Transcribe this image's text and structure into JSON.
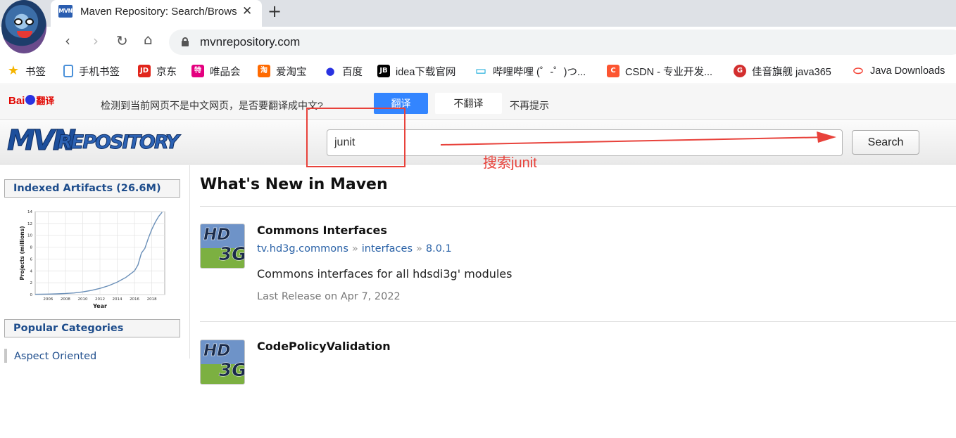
{
  "browser": {
    "tab_title": "Maven Repository: Search/Browse",
    "tab_favicon": "MVN",
    "url": "mvnrepository.com",
    "bookmarks": [
      {
        "label": "书签",
        "icon": "star-icon",
        "color": "#f5b400",
        "glyph": "★"
      },
      {
        "label": "手机书签",
        "icon": "mobile-bookmark-icon",
        "color": "#4a90d9",
        "glyph": ""
      },
      {
        "label": "京东",
        "icon": "jd-icon",
        "color": "#e1251b",
        "glyph": "JD"
      },
      {
        "label": "唯品会",
        "icon": "vip-icon",
        "color": "#e4007f",
        "glyph": "特"
      },
      {
        "label": "爱淘宝",
        "icon": "taobao-icon",
        "color": "#ff6a00",
        "glyph": "淘"
      },
      {
        "label": "百度",
        "icon": "baidu-paw-icon",
        "color": "#2932e1",
        "glyph": "●"
      },
      {
        "label": "idea下载官网",
        "icon": "jetbrains-icon",
        "color": "#000000",
        "glyph": "JB"
      },
      {
        "label": "哔哩哔哩 (゜-゜)つ...",
        "icon": "bilibili-icon",
        "color": "#00a1d6",
        "glyph": "▭"
      },
      {
        "label": "CSDN - 专业开发...",
        "icon": "csdn-icon",
        "color": "#fc5531",
        "glyph": "C"
      },
      {
        "label": "佳音旗舰 java365",
        "icon": "java365-icon",
        "color": "#d32f2f",
        "glyph": "G"
      },
      {
        "label": "Java Downloads",
        "icon": "oracle-icon",
        "color": "#f44336",
        "glyph": "⬭"
      }
    ]
  },
  "translate_bar": {
    "logo_text": "Baidu翻译",
    "message": "检测到当前网页不是中文网页，是否要翻译成中文?",
    "translate_label": "翻译",
    "no_translate_label": "不翻译",
    "never_label": "不再提示",
    "accent": "#3385ff"
  },
  "header": {
    "logo_big": "MVN",
    "logo_small": "REPOSITORY",
    "search_value": "junit",
    "search_button": "Search"
  },
  "annotation": {
    "text": "搜索junit",
    "color": "#e8423b"
  },
  "sidebar": {
    "indexed_label": "Indexed Artifacts (26.6M)",
    "categories_label": "Popular Categories",
    "first_category": "Aspect Oriented"
  },
  "main": {
    "title": "What's New in Maven",
    "items": [
      {
        "name": "Commons Interfaces",
        "group": "tv.hd3g.commons",
        "artifact": "interfaces",
        "version": "8.0.1",
        "description": "Commons interfaces for all hdsdi3g' modules",
        "date": "Last Release on Apr 7, 2022",
        "logo_top": "HD",
        "logo_bottom": "3G"
      },
      {
        "name": "CodePolicyValidation",
        "logo_top": "HD",
        "logo_bottom": "3G"
      }
    ]
  },
  "chart_data": {
    "type": "line",
    "title": "",
    "xlabel": "Year",
    "ylabel": "Projects (millions)",
    "x_ticks": [
      2006,
      2008,
      2010,
      2012,
      2014,
      2016,
      2018
    ],
    "y_ticks": [
      0,
      2,
      4,
      6,
      8,
      10,
      12,
      14
    ],
    "xlim": [
      2004.5,
      2019.5
    ],
    "ylim": [
      0,
      14
    ],
    "grid": true,
    "series": [
      {
        "x": [
          2004.5,
          2006,
          2007,
          2008,
          2009,
          2010,
          2011,
          2012,
          2013,
          2014,
          2015,
          2016,
          2016.4,
          2016.8,
          2017.2,
          2017.6,
          2018,
          2018.4,
          2018.8,
          2019.2
        ],
        "values": [
          0.05,
          0.08,
          0.12,
          0.18,
          0.28,
          0.45,
          0.7,
          1.05,
          1.5,
          2.1,
          2.9,
          4.0,
          5.0,
          7.0,
          7.8,
          9.5,
          11.0,
          12.2,
          13.2,
          13.9
        ],
        "color": "#6a8fb8"
      }
    ]
  }
}
